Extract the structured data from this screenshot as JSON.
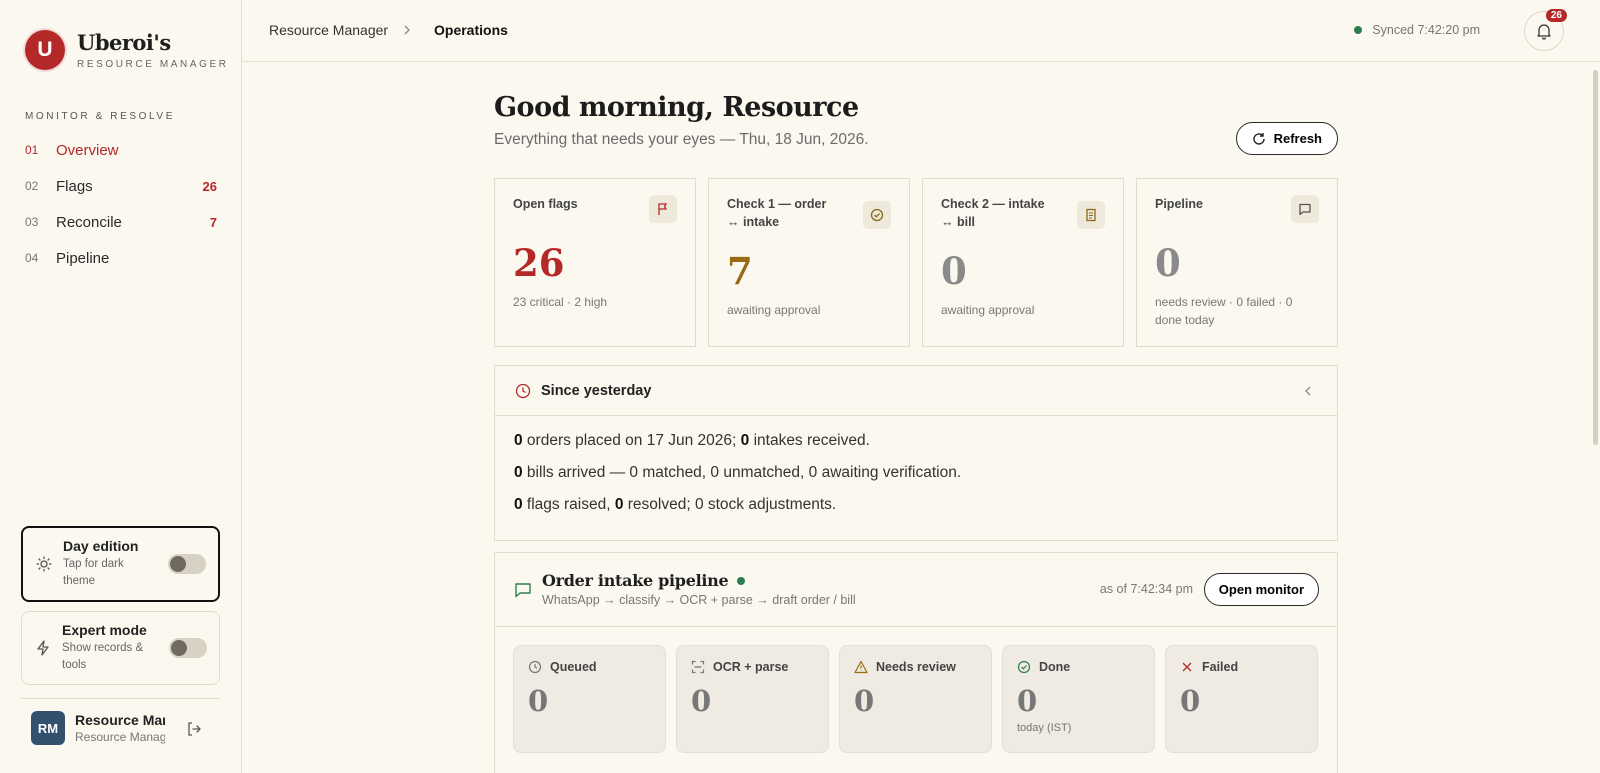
{
  "brand": {
    "initial": "U",
    "name": "Uberoi's",
    "subtitle": "RESOURCE MANAGER"
  },
  "sidebar": {
    "section_label": "MONITOR & RESOLVE",
    "items": [
      {
        "num": "01",
        "label": "Overview",
        "count": ""
      },
      {
        "num": "02",
        "label": "Flags",
        "count": "26"
      },
      {
        "num": "03",
        "label": "Reconcile",
        "count": "7"
      },
      {
        "num": "04",
        "label": "Pipeline",
        "count": ""
      }
    ],
    "day_edition": {
      "title": "Day edition",
      "desc": "Tap for dark theme"
    },
    "expert_mode": {
      "title": "Expert mode",
      "desc": "Show records & tools"
    },
    "user": {
      "initials": "RM",
      "name": "Resource Manager",
      "role": "Resource Manager"
    }
  },
  "topbar": {
    "crumbs": [
      "Resource Manager",
      "Operations"
    ],
    "synced": "Synced 7:42:20 pm",
    "notifications": "26"
  },
  "header": {
    "greeting": "Good morning, Resource",
    "subline": "Everything that needs your eyes — Thu, 18 Jun, 2026.",
    "refresh_label": "Refresh"
  },
  "stats": [
    {
      "label": "Open flags",
      "value": "26",
      "note": "23 critical · 2 high",
      "color": "#b42828"
    },
    {
      "label": "Check 1 — order ↔ intake",
      "value": "7",
      "note": "awaiting approval",
      "color": "#9a6a12"
    },
    {
      "label": "Check 2 — intake ↔ bill",
      "value": "0",
      "note": "awaiting approval",
      "color": "#8a8a8a"
    },
    {
      "label": "Pipeline",
      "value": "0",
      "note": "needs review · 0 failed · 0 done today",
      "color": "#8a8a8a"
    }
  ],
  "since": {
    "title": "Since yesterday",
    "lines": [
      {
        "a": "0",
        "b": " orders placed on 17 Jun 2026; ",
        "c": "0",
        "d": " intakes received."
      },
      {
        "a": "0",
        "b": " bills arrived — 0 matched, 0 unmatched, 0 awaiting verification.",
        "c": "",
        "d": ""
      },
      {
        "a": "0",
        "b": " flags raised, ",
        "c": "0",
        "d": " resolved; 0 stock adjustments."
      }
    ]
  },
  "pipeline": {
    "title": "Order intake pipeline",
    "flow": "WhatsApp → classify → OCR + parse → draft order / bill",
    "as_of": "as of 7:42:34 pm",
    "open_label": "Open monitor",
    "stages": [
      {
        "label": "Queued",
        "value": "0",
        "note": ""
      },
      {
        "label": "OCR + parse",
        "value": "0",
        "note": ""
      },
      {
        "label": "Needs review",
        "value": "0",
        "note": ""
      },
      {
        "label": "Done",
        "value": "0",
        "note": "today (IST)"
      },
      {
        "label": "Failed",
        "value": "0",
        "note": ""
      }
    ]
  },
  "colors": {
    "accent": "#b42828",
    "live": "#2e7d4f",
    "background": "#fbf8f0"
  }
}
